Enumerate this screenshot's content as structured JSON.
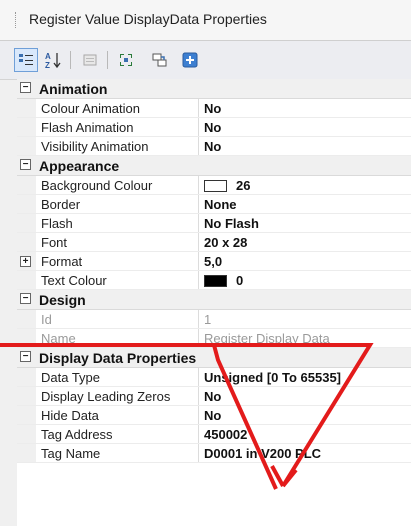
{
  "window": {
    "title": "Register Value DisplayData Properties"
  },
  "toolbar": {
    "buttons": [
      {
        "icon": "categorized-icon",
        "selected": true
      },
      {
        "icon": "alphabetical-icon",
        "selected": false
      },
      {
        "icon": "property-pages-icon",
        "selected": false
      },
      {
        "icon": "expand-all-icon",
        "selected": false
      },
      {
        "icon": "events-icon",
        "selected": false
      },
      {
        "icon": "add-icon",
        "selected": false
      }
    ]
  },
  "categories": {
    "animation": {
      "label": "Animation",
      "colour_animation": {
        "name": "Colour Animation",
        "value": "No"
      },
      "flash_animation": {
        "name": "Flash Animation",
        "value": "No"
      },
      "visibility_animation": {
        "name": "Visibility Animation",
        "value": "No"
      }
    },
    "appearance": {
      "label": "Appearance",
      "background_colour": {
        "name": "Background Colour",
        "value": "26",
        "swatch": "#ffffff"
      },
      "border": {
        "name": "Border",
        "value": "None"
      },
      "flash": {
        "name": "Flash",
        "value": "No Flash"
      },
      "font": {
        "name": "Font",
        "value": "20 x 28"
      },
      "format": {
        "name": "Format",
        "value": "5,0"
      },
      "text_colour": {
        "name": "Text Colour",
        "value": "0",
        "swatch": "#000000"
      }
    },
    "design": {
      "label": "Design",
      "id": {
        "name": "Id",
        "value": "1"
      },
      "name": {
        "name": "Name",
        "value": "Register Display Data"
      }
    },
    "display_data": {
      "label": "Display Data Properties",
      "data_type": {
        "name": "Data Type",
        "value": "Unsigned [0 To 65535]"
      },
      "display_leading_zeros": {
        "name": "Display Leading Zeros",
        "value": "No"
      },
      "hide_data": {
        "name": "Hide Data",
        "value": "No"
      },
      "tag_address": {
        "name": "Tag Address",
        "value": "450002"
      },
      "tag_name": {
        "name": "Tag Name",
        "value": "D0001 in V200 PLC"
      }
    }
  },
  "colors": {
    "annotation_arrow": "#e31b1b"
  }
}
